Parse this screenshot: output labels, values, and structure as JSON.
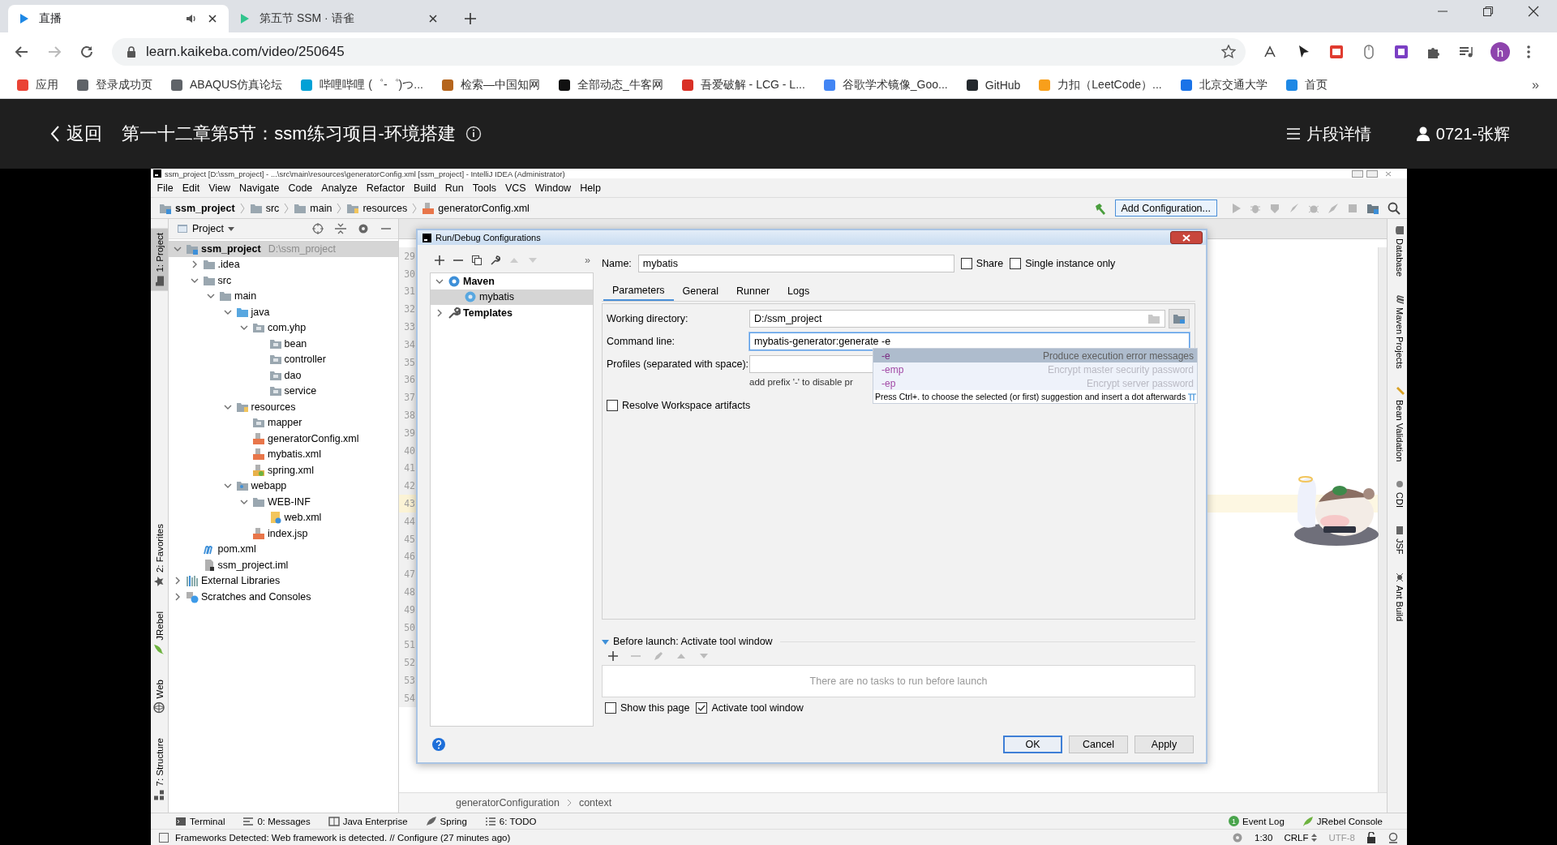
{
  "browser": {
    "tabs": [
      {
        "title": "直播",
        "selected": true,
        "audio": true,
        "color": "#1e88e5"
      },
      {
        "title": "第五节 SSM · 语雀",
        "selected": false,
        "audio": false,
        "color": "#31c48d"
      }
    ],
    "address": "learn.kaikeba.com/video/250645",
    "avatar": "h",
    "bookmarks": [
      {
        "label": "应用",
        "color": "#ea4335"
      },
      {
        "label": "登录成功页",
        "color": "#5f6368"
      },
      {
        "label": "ABAQUS仿真论坛",
        "color": "#5f6368"
      },
      {
        "label": "哔哩哔哩 (゜-゜)つ...",
        "color": "#00a1d6"
      },
      {
        "label": "检索—中国知网",
        "color": "#b5651d"
      },
      {
        "label": "全部动态_牛客网",
        "color": "#111111"
      },
      {
        "label": "吾爱破解 - LCG - L...",
        "color": "#d93025"
      },
      {
        "label": "谷歌学术镜像_Goo...",
        "color": "#4285f4"
      },
      {
        "label": "GitHub",
        "color": "#24292e"
      },
      {
        "label": "力扣（LeetCode）...",
        "color": "#f89f1b"
      },
      {
        "label": "北京交通大学",
        "color": "#1a73e8"
      },
      {
        "label": "首页",
        "color": "#1e88e5"
      }
    ],
    "more": "»"
  },
  "video_header": {
    "back": "返回",
    "title": "第一十二章第5节：ssm练习项目-环境搭建",
    "details": "片段详情",
    "user": "0721-张辉"
  },
  "ide": {
    "title": "ssm_project [D:\\ssm_project] - ...\\src\\main\\resources\\generatorConfig.xml [ssm_project] - IntelliJ IDEA (Administrator)",
    "menu": [
      "File",
      "Edit",
      "View",
      "Navigate",
      "Code",
      "Analyze",
      "Refactor",
      "Build",
      "Run",
      "Tools",
      "VCS",
      "Window",
      "Help"
    ],
    "breadcrumb": [
      {
        "label": "ssm_project",
        "kind": "module"
      },
      {
        "label": "src",
        "kind": "folder"
      },
      {
        "label": "main",
        "kind": "folder"
      },
      {
        "label": "resources",
        "kind": "resources"
      },
      {
        "label": "generatorConfig.xml",
        "kind": "xml"
      }
    ],
    "run_config": "Add Configuration...",
    "left_stripe_top": [
      {
        "label": "1: Project",
        "selected": true
      }
    ],
    "left_stripe_bottom": [
      {
        "label": "2: Favorites",
        "selected": false
      },
      {
        "label": "JRebel",
        "selected": false
      },
      {
        "label": "Web",
        "selected": false
      },
      {
        "label": "7: Structure",
        "selected": false
      }
    ],
    "project_panel": {
      "title": "Project",
      "tree": [
        {
          "label": "ssm_project",
          "kind": "module",
          "hint": "D:\\ssm_project",
          "expanded": true,
          "selected": true,
          "children": [
            {
              "label": ".idea",
              "kind": "folder",
              "expanded": false,
              "selected": false
            },
            {
              "label": "src",
              "kind": "folder",
              "expanded": true,
              "selected": false,
              "children": [
                {
                  "label": "main",
                  "kind": "folder",
                  "expanded": true,
                  "selected": false,
                  "children": [
                    {
                      "label": "java",
                      "kind": "source",
                      "expanded": true,
                      "selected": false,
                      "children": [
                        {
                          "label": "com.yhp",
                          "kind": "package",
                          "expanded": true,
                          "selected": false,
                          "children": [
                            {
                              "label": "bean",
                              "kind": "package",
                              "selected": false
                            },
                            {
                              "label": "controller",
                              "kind": "package",
                              "selected": false
                            },
                            {
                              "label": "dao",
                              "kind": "package",
                              "selected": false
                            },
                            {
                              "label": "service",
                              "kind": "package",
                              "selected": false
                            }
                          ]
                        }
                      ]
                    },
                    {
                      "label": "resources",
                      "kind": "resources",
                      "expanded": true,
                      "selected": false,
                      "children": [
                        {
                          "label": "mapper",
                          "kind": "package",
                          "selected": false
                        },
                        {
                          "label": "generatorConfig.xml",
                          "kind": "xml",
                          "selected": false
                        },
                        {
                          "label": "mybatis.xml",
                          "kind": "xml",
                          "selected": false
                        },
                        {
                          "label": "spring.xml",
                          "kind": "spring",
                          "selected": false
                        }
                      ]
                    },
                    {
                      "label": "webapp",
                      "kind": "web",
                      "expanded": true,
                      "selected": false,
                      "children": [
                        {
                          "label": "WEB-INF",
                          "kind": "folder",
                          "expanded": true,
                          "selected": false,
                          "children": [
                            {
                              "label": "web.xml",
                              "kind": "webxml",
                              "selected": false
                            }
                          ]
                        },
                        {
                          "label": "index.jsp",
                          "kind": "jsp",
                          "selected": false
                        }
                      ]
                    }
                  ]
                }
              ]
            },
            {
              "label": "pom.xml",
              "kind": "maven",
              "selected": false
            },
            {
              "label": "ssm_project.iml",
              "kind": "iml",
              "selected": false
            }
          ]
        },
        {
          "label": "External Libraries",
          "kind": "libraries",
          "expanded": false,
          "selected": false
        },
        {
          "label": "Scratches and Consoles",
          "kind": "scratches",
          "expanded": false,
          "selected": false
        }
      ]
    },
    "gutter": [
      {
        "number": "29",
        "current": false
      },
      {
        "number": "30",
        "current": false
      },
      {
        "number": "31",
        "current": false
      },
      {
        "number": "32",
        "current": false
      },
      {
        "number": "33",
        "current": false
      },
      {
        "number": "34",
        "current": false
      },
      {
        "number": "35",
        "current": false
      },
      {
        "number": "36",
        "current": false
      },
      {
        "number": "37",
        "current": false
      },
      {
        "number": "38",
        "current": false
      },
      {
        "number": "39",
        "current": false
      },
      {
        "number": "40",
        "current": false
      },
      {
        "number": "41",
        "current": false
      },
      {
        "number": "42",
        "current": false
      },
      {
        "number": "43",
        "current": true
      },
      {
        "number": "44",
        "current": false
      },
      {
        "number": "45",
        "current": false
      },
      {
        "number": "46",
        "current": false
      },
      {
        "number": "47",
        "current": false
      },
      {
        "number": "48",
        "current": false
      },
      {
        "number": "49",
        "current": false
      },
      {
        "number": "50",
        "current": false
      },
      {
        "number": "51",
        "current": false
      },
      {
        "number": "52",
        "current": false
      },
      {
        "number": "53",
        "current": false
      },
      {
        "number": "54",
        "current": false
      }
    ],
    "editor_breadcrumb": [
      "generatorConfiguration",
      "context"
    ],
    "right_stripe": [
      "Database",
      "Maven Projects",
      "Bean Validation",
      "CDI",
      "JSF",
      "Ant Build"
    ],
    "bottom_tools": [
      "Terminal",
      "0: Messages",
      "Java Enterprise",
      "Spring",
      "6: TODO"
    ],
    "event_log": {
      "label": "Event Log",
      "badge": "1"
    },
    "jrebel_console": "JRebel Console",
    "status": {
      "message": "Frameworks Detected: Web framework is detected. // Configure (27 minutes ago)",
      "position": "1:30",
      "line_separator": "CRLF",
      "encoding": "UTF-8"
    }
  },
  "dialog": {
    "title": "Run/Debug Configurations",
    "more": "»",
    "tree": [
      {
        "label": "Maven",
        "kind": "maven-type",
        "expanded": true,
        "selected": false,
        "children": [
          {
            "label": "mybatis",
            "kind": "config",
            "selected": true
          }
        ]
      },
      {
        "label": "Templates",
        "kind": "templates",
        "expanded": false,
        "selected": false
      }
    ],
    "name_label": "Name:",
    "name": "mybatis",
    "options": [
      {
        "label": "Share",
        "checked": false
      },
      {
        "label": "Single instance only",
        "checked": false
      }
    ],
    "tabs": [
      {
        "label": "Parameters",
        "selected": true
      },
      {
        "label": "General",
        "selected": false
      },
      {
        "label": "Runner",
        "selected": false
      },
      {
        "label": "Logs",
        "selected": false
      }
    ],
    "working_directory": {
      "label": "Working directory:",
      "value": "D:/ssm_project"
    },
    "command_line": {
      "label": "Command line:",
      "value": "mybatis-generator:generate -e"
    },
    "profiles": {
      "label": "Profiles (separated with space):",
      "hint": "add prefix '-' to disable pr"
    },
    "resolve": {
      "label": "Resolve Workspace artifacts",
      "checked": false
    },
    "completion": {
      "items": [
        {
          "option": "-e",
          "description": "Produce execution error messages",
          "selected": true
        },
        {
          "option": "-emp",
          "description": "Encrypt master security password",
          "selected": false
        },
        {
          "option": "-ep",
          "description": "Encrypt server password",
          "selected": false
        }
      ],
      "footer": "Press Ctrl+. to choose the selected (or first) suggestion and insert a dot afterwards"
    },
    "before_launch": {
      "title": "Before launch: Activate tool window",
      "expanded": true,
      "empty": "There are no tasks to run before launch"
    },
    "launch_options": [
      {
        "label": "Show this page",
        "checked": false
      },
      {
        "label": "Activate tool window",
        "checked": true
      }
    ],
    "buttons": [
      {
        "label": "OK",
        "default": true
      },
      {
        "label": "Cancel",
        "default": false
      },
      {
        "label": "Apply",
        "default": false
      }
    ]
  }
}
